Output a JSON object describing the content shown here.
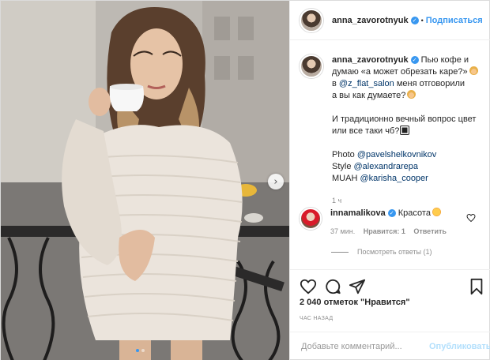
{
  "post": {
    "username": "anna_zavorotnyuk",
    "verified_glyph": "✓",
    "separator": "•",
    "follow_label": "Подписаться",
    "caption": {
      "username": "anna_zavorotnyuk",
      "line1": " Пью кофе и думаю «а может обрезать каре?»",
      "line2_prefix": "в ",
      "mention_salon": "@z_flat_salon",
      "line2_suffix": " меня отговорили",
      "line3": "а вы как думаете?",
      "line4": "И традиционно вечный вопрос цвет или все таки чб?",
      "photo_label": "Photo ",
      "photo_mention": "@pavelshelkovnikov",
      "style_label": "Style ",
      "style_mention": "@alexandrarepa",
      "muah_label": "MUAH ",
      "muah_mention": "@karisha_cooper",
      "time": "1 ч"
    },
    "comment": {
      "username": "innamalikova",
      "text": " Красота",
      "time": "37 мин.",
      "likes": "Нравится: 1",
      "reply": "Ответить",
      "view_replies": "Посмотреть ответы (1)"
    },
    "likes_text": "2 040 отметок \"Нравится\"",
    "time_ago": "ЧАС НАЗАД",
    "add_comment_placeholder": "Добавьте комментарий...",
    "publish_label": "Опубликовать",
    "next_arrow": "›",
    "carousel": {
      "current": 1,
      "total": 2
    }
  },
  "icons": {
    "header_avatar": "avatar-icon",
    "like": "heart-icon",
    "comment": "comment-icon",
    "share": "share-icon",
    "save": "bookmark-icon",
    "comment_like": "heart-icon"
  },
  "colors": {
    "accent": "#3897f0",
    "link": "#003569",
    "muted": "#8e8e8e",
    "publish_disabled": "#b2dffc",
    "border": "#efefef"
  }
}
